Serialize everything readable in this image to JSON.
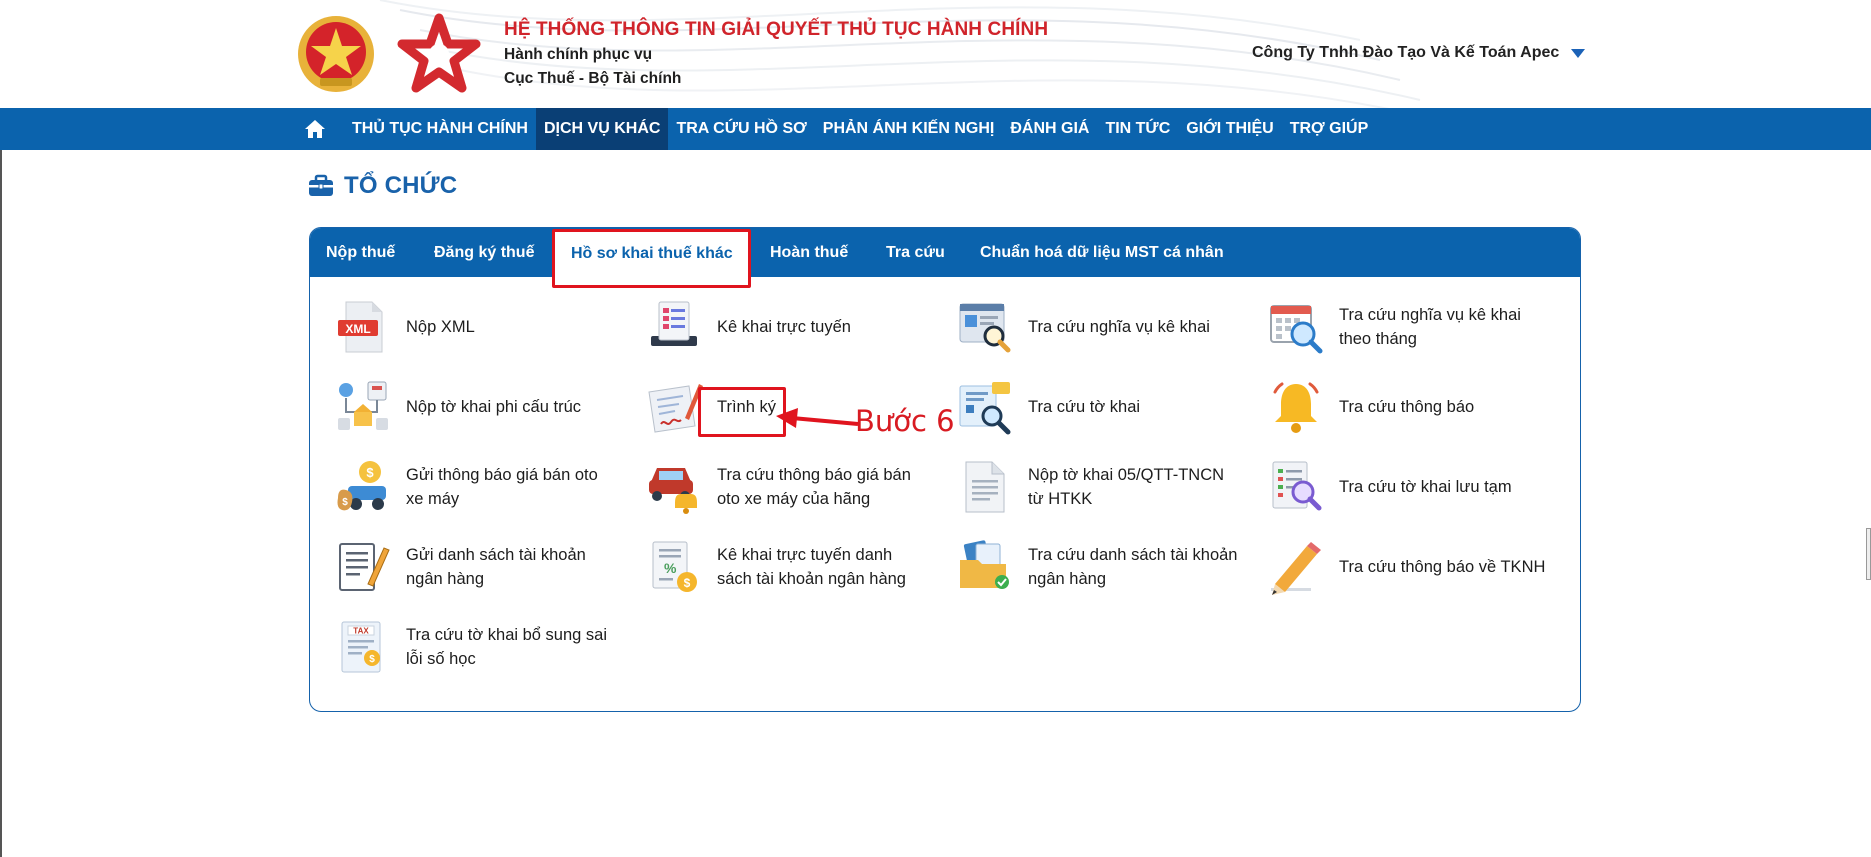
{
  "header": {
    "title": "HỆ THỐNG THÔNG TIN GIẢI QUYẾT THỦ TỤC HÀNH CHÍNH",
    "subtitle_1": "Hành chính phục vụ",
    "subtitle_2": "Cục Thuế - Bộ Tài chính",
    "user_name": "Công Ty Tnhh Đào Tạo Và Kế Toán Apec"
  },
  "nav": {
    "items": [
      {
        "label": "THỦ TỤC HÀNH CHÍNH",
        "active": false
      },
      {
        "label": "DỊCH VỤ KHÁC",
        "active": true
      },
      {
        "label": "TRA CỨU HỒ SƠ",
        "active": false
      },
      {
        "label": "PHẢN ÁNH KIẾN NGHỊ",
        "active": false
      },
      {
        "label": "ĐÁNH GIÁ",
        "active": false
      },
      {
        "label": "TIN TỨC",
        "active": false
      },
      {
        "label": "GIỚI THIỆU",
        "active": false
      },
      {
        "label": "TRỢ GIÚP",
        "active": false
      }
    ]
  },
  "page": {
    "title": "TỔ CHỨC"
  },
  "tabs": [
    {
      "label": "Nộp thuế",
      "active": false
    },
    {
      "label": "Đăng ký thuế",
      "active": false
    },
    {
      "label": "Hồ sơ khai thuế khác",
      "active": true
    },
    {
      "label": "Hoàn thuế",
      "active": false
    },
    {
      "label": "Tra cứu",
      "active": false
    },
    {
      "label": "Chuẩn hoá dữ liệu MST cá nhân",
      "active": false
    }
  ],
  "items": [
    {
      "label": "Nộp XML",
      "icon": "xml-file-icon"
    },
    {
      "label": "Kê khai trực tuyến",
      "icon": "online-declaration-icon"
    },
    {
      "label": "Tra cứu nghĩa vụ kê khai",
      "icon": "search-obligation-icon"
    },
    {
      "label": "Tra cứu nghĩa vụ kê khai theo tháng",
      "icon": "calendar-search-icon"
    },
    {
      "label": "Nộp tờ khai phi cấu trúc",
      "icon": "unstructured-form-icon"
    },
    {
      "label": "Trình ký",
      "icon": "sign-document-icon"
    },
    {
      "label": "Tra cứu tờ khai",
      "icon": "search-form-icon"
    },
    {
      "label": "Tra cứu thông báo",
      "icon": "bell-icon"
    },
    {
      "label": "Gửi thông báo giá bán oto xe máy",
      "icon": "vehicle-money-icon"
    },
    {
      "label": "Tra cứu thông báo giá bán oto xe máy của hãng",
      "icon": "car-bell-icon"
    },
    {
      "label": "Nộp tờ khai 05/QTT-TNCN từ HTKK",
      "icon": "document-icon"
    },
    {
      "label": "Tra cứu tờ khai lưu tạm",
      "icon": "draft-search-icon"
    },
    {
      "label": "Gửi danh sách tài khoản ngân hàng",
      "icon": "bank-list-pen-icon"
    },
    {
      "label": "Kê khai trực tuyến danh sách tài khoản ngân hàng",
      "icon": "bank-list-coin-icon"
    },
    {
      "label": "Tra cứu danh sách tài khoản ngân hàng",
      "icon": "folder-check-icon"
    },
    {
      "label": "Tra cứu thông báo về TKNH",
      "icon": "pencil-icon"
    },
    {
      "label": "Tra cứu tờ khai bổ sung sai lỗi số học",
      "icon": "tax-form-icon"
    }
  ],
  "annotation": {
    "step_label": "Bước 6"
  },
  "colors": {
    "nav_blue": "#0b63ad",
    "nav_active": "#0a3f75",
    "title_red": "#d0242b",
    "page_title_blue": "#1962aa",
    "highlight_red": "#e0141e"
  }
}
